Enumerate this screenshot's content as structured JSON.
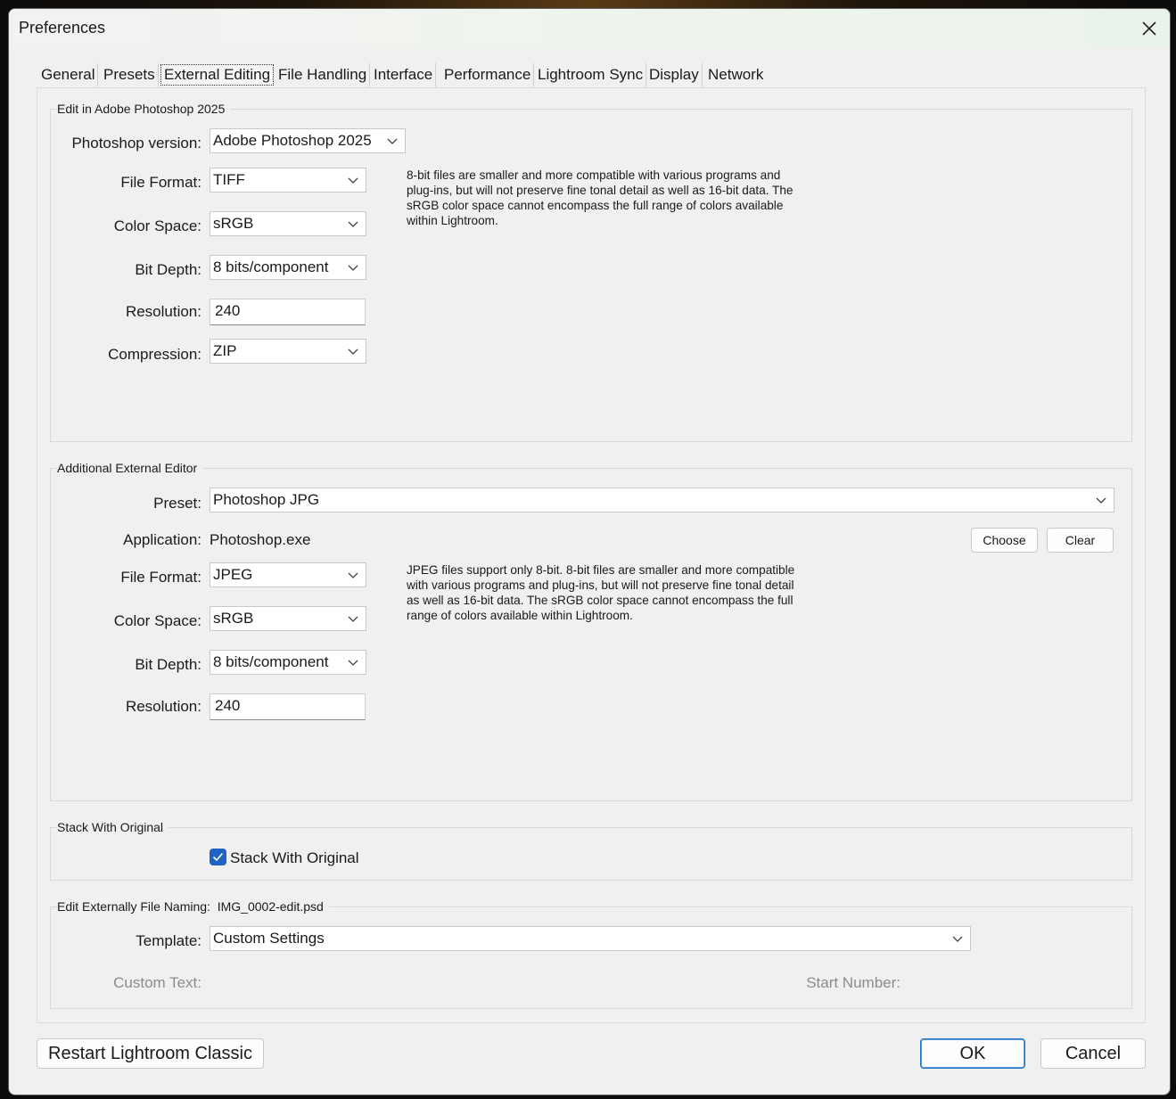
{
  "window": {
    "title": "Preferences"
  },
  "tabs": [
    {
      "label": "General"
    },
    {
      "label": "Presets"
    },
    {
      "label": "External Editing",
      "active": true
    },
    {
      "label": "File Handling"
    },
    {
      "label": "Interface"
    },
    {
      "label": "Performance"
    },
    {
      "label": "Lightroom Sync"
    },
    {
      "label": "Display"
    },
    {
      "label": "Network"
    }
  ],
  "photoshop_group": {
    "title": "Edit in Adobe Photoshop 2025",
    "version_label": "Photoshop version:",
    "version_value": "Adobe Photoshop 2025",
    "file_format_label": "File Format:",
    "file_format_value": "TIFF",
    "color_space_label": "Color Space:",
    "color_space_value": "sRGB",
    "bit_depth_label": "Bit Depth:",
    "bit_depth_value": "8 bits/component",
    "resolution_label": "Resolution:",
    "resolution_value": "240",
    "compression_label": "Compression:",
    "compression_value": "ZIP",
    "description": [
      "8-bit files are smaller and more compatible with various programs and",
      "plug-ins, but will not preserve fine tonal detail as well as 16-bit data. The",
      "sRGB color space cannot encompass the full range of colors available",
      "within Lightroom."
    ]
  },
  "additional_group": {
    "title": "Additional External Editor",
    "preset_label": "Preset:",
    "preset_value": "Photoshop JPG",
    "application_label": "Application:",
    "application_value": "Photoshop.exe",
    "choose_label": "Choose",
    "clear_label": "Clear",
    "file_format_label": "File Format:",
    "file_format_value": "JPEG",
    "color_space_label": "Color Space:",
    "color_space_value": "sRGB",
    "bit_depth_label": "Bit Depth:",
    "bit_depth_value": "8 bits/component",
    "resolution_label": "Resolution:",
    "resolution_value": "240",
    "description": [
      "JPEG files support only 8-bit. 8-bit files are smaller and more compatible",
      "with various programs and plug-ins, but will not preserve fine tonal detail",
      "as well as 16-bit data. The sRGB color space cannot encompass the full",
      "range of colors available within Lightroom."
    ]
  },
  "stack_group": {
    "title": "Stack With Original",
    "checkbox_label": "Stack With Original",
    "checked": true
  },
  "naming_group": {
    "title": "Edit Externally File Naming:",
    "example": "IMG_0002-edit.psd",
    "template_label": "Template:",
    "template_value": "Custom Settings",
    "custom_text_label": "Custom Text:",
    "start_number_label": "Start Number:"
  },
  "footer": {
    "restart_label": "Restart Lightroom Classic",
    "ok_label": "OK",
    "cancel_label": "Cancel"
  },
  "colors": {
    "accent": "#1e63c2",
    "window_bg": "#f0f0f0",
    "disabled_text": "#8c8c8c"
  },
  "icons": {
    "close": "close-icon",
    "dropdown": "chevron-down-icon",
    "check": "check-icon"
  }
}
